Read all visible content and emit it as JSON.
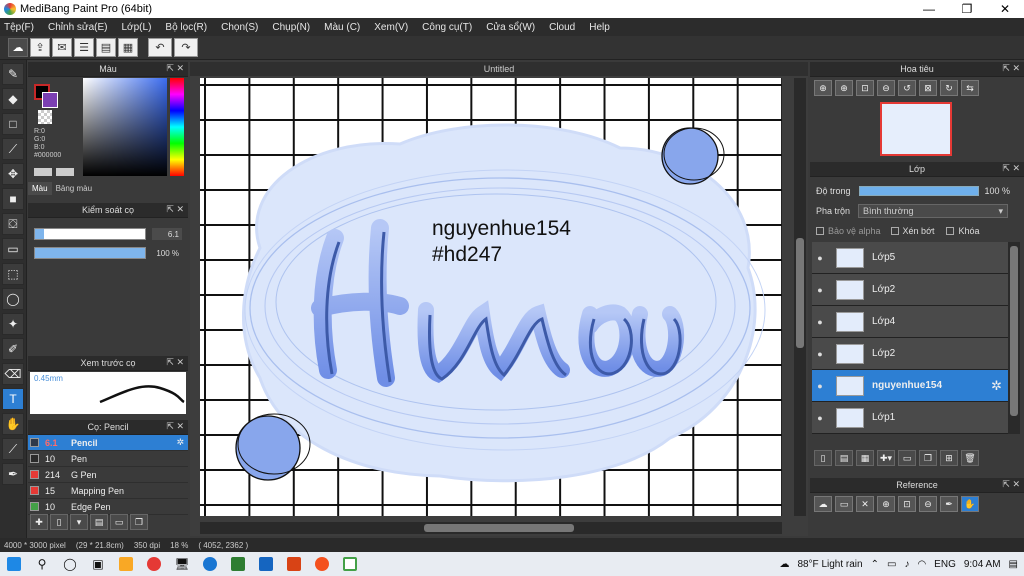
{
  "window": {
    "title": "MediBang Paint Pro (64bit)",
    "minimize": "—",
    "restore": "❐",
    "close": "✕"
  },
  "menu": [
    "Tệp(F)",
    "Chỉnh sửa(E)",
    "Lớp(L)",
    "Bộ lọc(R)",
    "Chọn(S)",
    "Chụp(N)",
    "Màu (C)",
    "Xem(V)",
    "Công cụ(T)",
    "Cửa sổ(W)",
    "Cloud",
    "Help"
  ],
  "color_panel": {
    "title": "Màu",
    "rgb": "R:0\nG:0\nB:0\n#000000",
    "tab_color": "Màu",
    "tab_palette": "Bảng màu"
  },
  "brush_control": {
    "title": "Kiểm soát cọ",
    "size_value": "6.1",
    "opacity_value": "100 %",
    "size_fraction": 0.08,
    "opacity_fraction": 1.0
  },
  "brush_preview": {
    "title": "Xem trước cọ",
    "size": "0.45mm"
  },
  "brush_list": {
    "title": "Cọ: Pencil",
    "items": [
      {
        "size": "6.1",
        "name": "Pencil",
        "color": "#2f3a4a",
        "selected": true
      },
      {
        "size": "10",
        "name": "Pen",
        "color": "#2a2a2a",
        "selected": false
      },
      {
        "size": "214",
        "name": "G Pen",
        "color": "#e53935",
        "selected": false
      },
      {
        "size": "15",
        "name": "Mapping Pen",
        "color": "#e53935",
        "selected": false
      },
      {
        "size": "10",
        "name": "Edge Pen",
        "color": "#43a047",
        "selected": false
      }
    ]
  },
  "canvas": {
    "tab": "Untitled",
    "text_line1": "nguyenhue154",
    "text_line2": "#hd247"
  },
  "navigator": {
    "title": "Hoa tiêu"
  },
  "layers": {
    "title": "Lớp",
    "opacity_label": "Độ trong",
    "opacity_value": "100 %",
    "blend_label": "Pha trộn",
    "blend_value": "Bình thường",
    "protect_alpha": "Bảo vệ alpha",
    "clipping": "Xén bớt",
    "lock": "Khóa",
    "items": [
      {
        "name": "Lớp5",
        "selected": false
      },
      {
        "name": "Lớp2",
        "selected": false
      },
      {
        "name": "Lớp4",
        "selected": false
      },
      {
        "name": "Lớp2",
        "selected": false
      },
      {
        "name": "nguyenhue154",
        "selected": true
      },
      {
        "name": "Lớp1",
        "selected": false
      }
    ]
  },
  "reference": {
    "title": "Reference"
  },
  "status": {
    "size": "4000 * 3000 pixel",
    "cm": "(29 * 21.8cm)",
    "dpi": "350 dpi",
    "zoom": "18 %",
    "coords": "( 4052, 2362 )"
  },
  "taskbar": {
    "weather": "88°F  Light rain",
    "lang": "ENG",
    "time": "9:04 AM"
  }
}
